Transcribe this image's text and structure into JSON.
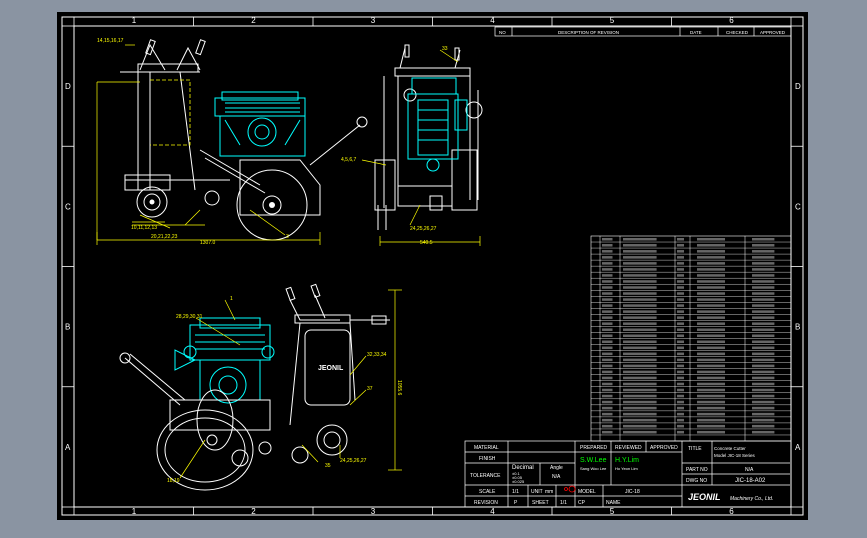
{
  "grid": {
    "columns": [
      "1",
      "2",
      "3",
      "4",
      "5",
      "6"
    ],
    "rows": [
      "D",
      "C",
      "B",
      "A"
    ]
  },
  "revision_header": {
    "no": "NO",
    "description": "DESCRIPTION OF REVISION",
    "date": "DATE",
    "checked": "CHECKED",
    "approved": "APPROVED"
  },
  "callouts": {
    "side_top": "14,15,16,17",
    "side_mid": "10,11,12,13",
    "side_low": "20,21,22,23",
    "side_dim": "1307.0",
    "side_left_dim": "1302",
    "side_right": "3",
    "front_top": "33",
    "front_mid": "4,5,6,7",
    "front_low": "24,25,26,27",
    "front_dim": "540.5",
    "iso_top": "28,29,30,31",
    "iso_right1": "32,33,34",
    "iso_right2": "37",
    "iso_right3": "35",
    "iso_low": "18,19",
    "iso_low2": "24,25,26,27",
    "iso_right_dim": "1055.6",
    "iso_label": "1"
  },
  "brand_plate": "JEONIL",
  "title_block": {
    "material_label": "MATERIAL",
    "finish_label": "FINISH",
    "tolerance_label": "TOLERANCE",
    "decimal_label": "Decimal",
    "angle_label": "Angle",
    "tol1": "±0.1",
    "tol2": "±0.05",
    "tol3": "±0.025",
    "angle_val": "N/A",
    "scale_label": "SCALE",
    "scale_val": "1/1",
    "unit_label": "UNIT",
    "unit_val": "mm",
    "revision_label": "REVISION",
    "revision_val": "P",
    "sheet_label": "SHEET",
    "sheet_val": "1/1",
    "prepared_label": "PREPARED",
    "reviewed_label": "REVIEWED",
    "approved_label": "APPROVED",
    "prepared_name": "S.W.Lee",
    "reviewed_name": "H.Y.Lim",
    "prepared_sub": "Sang Woo Lee",
    "reviewed_sub": "Ho Yeon Lim",
    "model_label": "MODEL",
    "model_val": "JIC-18",
    "cp_label": "CP",
    "name_label": "NAME",
    "title_label": "TITLE",
    "title_line1": "Concrete Cutter",
    "title_line2": "Model JIC-18 Series",
    "partno_label": "PART NO",
    "partno_val": "N/A",
    "dwgno_label": "DWG NO",
    "dwgno_val": "JIC-18-A02",
    "company_logo": "JEONIL",
    "company_name": "Machinery Co., Ltd."
  },
  "bom": {
    "rows": 34
  }
}
